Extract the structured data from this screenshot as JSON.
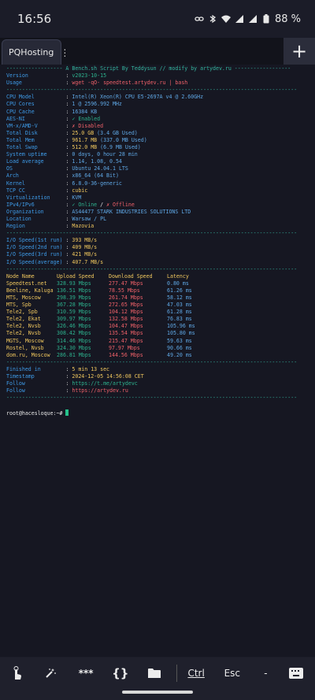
{
  "status": {
    "time": "16:56",
    "battery": "88 %",
    "icons": [
      "link-icon",
      "bluetooth-icon",
      "wifi-icon",
      "signal-icon",
      "signal-icon",
      "battery-icon"
    ]
  },
  "tabs": [
    {
      "label": "PQHosting",
      "menu": "⋮"
    }
  ],
  "add_tab": "+",
  "term": {
    "title_line": "------------------ A Bench.sh Script By Teddysun // modify by artydev.ru ------------------",
    "sep_line": "---------------------------------------------------------------------------------------------",
    "info": [
      {
        "k": "Version",
        "v": "v2023-10-15",
        "c": "g"
      },
      {
        "k": "Usage",
        "v": "wget -qO- speedtest.artydev.ru | bash",
        "c": "r"
      }
    ],
    "sys": [
      {
        "k": "CPU Model",
        "v": "Intel(R) Xeon(R) CPU E5-2697A v4 @ 2.60GHz",
        "c": "b"
      },
      {
        "k": "CPU Cores",
        "v": "1 @ 2596.992 MHz",
        "c": "b"
      },
      {
        "k": "CPU Cache",
        "v": "16384 KB",
        "c": "b"
      },
      {
        "k": "AES-NI",
        "v": "✓ Enabled",
        "c": "g"
      },
      {
        "k": "VM-x/AMD-V",
        "v": "✗ Disabled",
        "c": "r"
      },
      {
        "k": "Total Disk",
        "v": "25.0 GB",
        "v2": " (3.4 GB Used)",
        "c": "y",
        "c2": "b"
      },
      {
        "k": "Total Mem",
        "v": "961.7 MB",
        "v2": " (337.0 MB Used)",
        "c": "y",
        "c2": "b"
      },
      {
        "k": "Total Swap",
        "v": "512.0 MB",
        "v2": " (6.9 MB Used)",
        "c": "y",
        "c2": "b"
      },
      {
        "k": "System uptime",
        "v": "0 days, 0 hour 28 min",
        "c": "b"
      },
      {
        "k": "Load average",
        "v": "1.14, 1.08, 0.54",
        "c": "b"
      },
      {
        "k": "OS",
        "v": "Ubuntu 24.04.1 LTS",
        "c": "b"
      },
      {
        "k": "Arch",
        "v": "x86_64 (64 Bit)",
        "c": "b"
      },
      {
        "k": "Kernel",
        "v": "6.8.0-36-generic",
        "c": "b"
      },
      {
        "k": "TCP CC",
        "v": "cubic",
        "c": "y"
      },
      {
        "k": "Virtualization",
        "v": "KVM",
        "c": "b"
      },
      {
        "k": "IPv4/IPv6",
        "v": "✓ Online",
        "v2": " / ",
        "v3": "✗ Offline",
        "c": "g",
        "c2": "w",
        "c3": "r"
      },
      {
        "k": "Organization",
        "v": "AS44477 STARK INDUSTRIES SOLUTIONS LTD",
        "c": "b"
      },
      {
        "k": "Location",
        "v": "Warsaw / PL",
        "c": "b"
      },
      {
        "k": "Region",
        "v": "Mazovia",
        "c": "y"
      }
    ],
    "io": [
      {
        "k": "I/O Speed(1st run)",
        "v": "393 MB/s"
      },
      {
        "k": "I/O Speed(2nd run)",
        "v": "409 MB/s"
      },
      {
        "k": "I/O Speed(3rd run)",
        "v": "421 MB/s"
      },
      {
        "k": "I/O Speed(average)",
        "v": "407.7 MB/s"
      }
    ],
    "speed_headers": [
      "Node Name",
      "Upload Speed",
      "Download Speed",
      "Latency"
    ],
    "speed_rows": [
      [
        "Speedtest.net",
        "328.93 Mbps",
        "277.47 Mbps",
        "0.80 ms"
      ],
      [
        "Beeline, Kaluga",
        "136.51 Mbps",
        "78.55 Mbps",
        "61.26 ms"
      ],
      [
        "MTS, Moscow",
        "298.39 Mbps",
        "261.74 Mbps",
        "58.12 ms"
      ],
      [
        "MTS, Spb",
        "367.28 Mbps",
        "272.65 Mbps",
        "47.03 ms"
      ],
      [
        "Tele2, Spb",
        "310.59 Mbps",
        "104.12 Mbps",
        "61.28 ms"
      ],
      [
        "Tele2, Ekat",
        "309.97 Mbps",
        "132.58 Mbps",
        "76.83 ms"
      ],
      [
        "Tele2, Nvsb",
        "326.46 Mbps",
        "104.47 Mbps",
        "105.96 ms"
      ],
      [
        "Tele2, Nvsb",
        "308.42 Mbps",
        "135.54 Mbps",
        "105.80 ms"
      ],
      [
        "MGTS, Moscow",
        "314.46 Mbps",
        "215.47 Mbps",
        "59.63 ms"
      ],
      [
        "Rostel, Nvsb",
        "324.30 Mbps",
        "97.97 Mbps",
        "90.66 ms"
      ],
      [
        "dom.ru, Moscow",
        "286.81 Mbps",
        "144.56 Mbps",
        "49.20 ms"
      ]
    ],
    "footer": [
      {
        "k": "Finished in",
        "v": "5 min 13 sec",
        "c": "y"
      },
      {
        "k": "Timestamp",
        "v": "2024-12-05 14:56:08 CET",
        "c": "y"
      },
      {
        "k": "Follow",
        "v": "https://t.me/artydevc",
        "c": "g"
      },
      {
        "k": "Follow",
        "v": "https://artydev.ru",
        "c": "r"
      }
    ],
    "prompt": "root@hacesloque:~#"
  },
  "bottom": {
    "ctrl": "Ctrl",
    "esc": "Esc",
    "dash": "-",
    "stars": "***",
    "braces": "{}"
  }
}
